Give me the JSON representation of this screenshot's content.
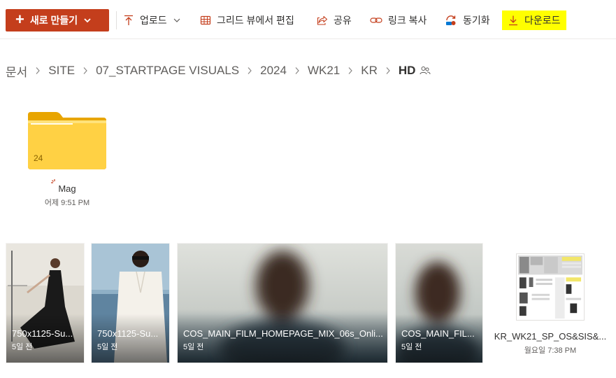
{
  "toolbar": {
    "new_label": "새로 만들기",
    "upload_label": "업로드",
    "grid_edit_label": "그리드 뷰에서 편집",
    "share_label": "공유",
    "copy_link_label": "링크 복사",
    "sync_label": "동기화",
    "download_label": "다운로드"
  },
  "breadcrumb": {
    "items": [
      "문서",
      "SITE",
      "07_STARTPAGE VISUALS",
      "2024",
      "WK21",
      "KR"
    ],
    "current": "HD"
  },
  "folder": {
    "count": "24",
    "name": "Mag",
    "date": "어제 9:51 PM"
  },
  "files": [
    {
      "name": "750x1125-Su...",
      "date": "5일 전"
    },
    {
      "name": "750x1125-Su...",
      "date": "5일 전"
    },
    {
      "name": "COS_MAIN_FILM_HOMEPAGE_MIX_06s_Onli...",
      "date": "5일 전"
    },
    {
      "name": "COS_MAIN_FIL...",
      "date": "5일 전"
    },
    {
      "name": "KR_WK21_SP_OS&SIS&...",
      "date": "월요일 7:38 PM"
    }
  ],
  "colors": {
    "accent": "#c43e1c",
    "highlight": "#ffff00",
    "folder": "#ffd144"
  },
  "icons": [
    "plus-icon",
    "chevron-down-icon",
    "upload-icon",
    "grid-icon",
    "share-icon",
    "link-icon",
    "sync-icon",
    "download-icon",
    "chevron-right-icon",
    "people-icon",
    "folder-icon",
    "new-spark-icon"
  ]
}
